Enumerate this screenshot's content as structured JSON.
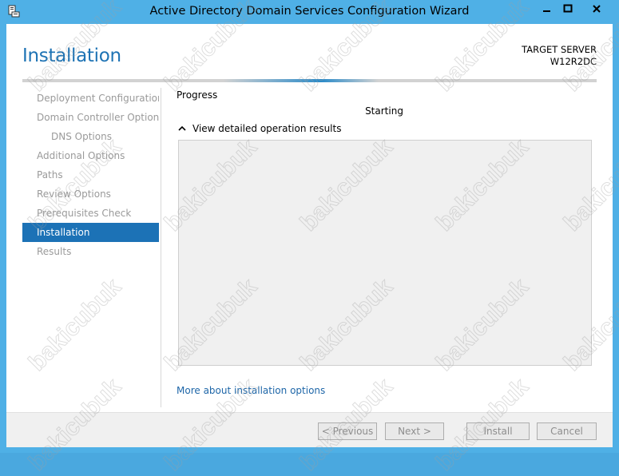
{
  "window": {
    "title": "Active Directory Domain Services Configuration Wizard",
    "icon": "server-manager-icon",
    "controls": [
      "minimize-icon",
      "maximize-icon",
      "close-icon"
    ]
  },
  "header": {
    "page_title": "Installation",
    "target_label": "TARGET SERVER",
    "target_name": "W12R2DC"
  },
  "nav": {
    "items": [
      {
        "label": "Deployment Configuration"
      },
      {
        "label": "Domain Controller Options"
      },
      {
        "label": "DNS Options"
      },
      {
        "label": "Additional Options"
      },
      {
        "label": "Paths"
      },
      {
        "label": "Review Options"
      },
      {
        "label": "Prerequisites Check"
      },
      {
        "label": "Installation"
      },
      {
        "label": "Results"
      }
    ],
    "active": "Installation"
  },
  "content": {
    "section_label": "Progress",
    "status": "Starting",
    "toggle_label": "View detailed operation results",
    "more_link": "More about installation options"
  },
  "footer": {
    "previous": "< Previous",
    "next": "Next >",
    "install": "Install",
    "cancel": "Cancel"
  },
  "watermark": "bakicubuk",
  "colors": {
    "accent": "#1c72b6",
    "title_blue": "#1e73b4",
    "frame": "#4fb0e6",
    "link": "#1e66a8"
  }
}
